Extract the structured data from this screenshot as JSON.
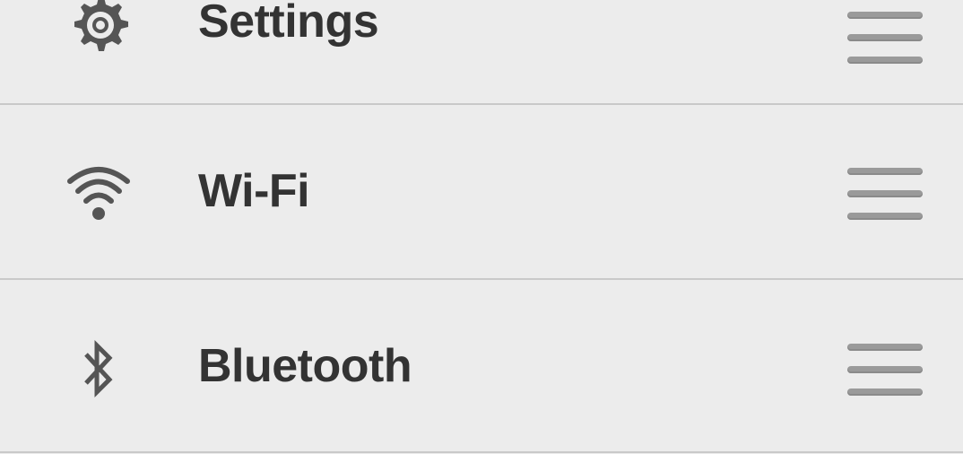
{
  "items": [
    {
      "label": "Settings",
      "icon": "gear-icon"
    },
    {
      "label": "Wi-Fi",
      "icon": "wifi-icon"
    },
    {
      "label": "Bluetooth",
      "icon": "bluetooth-icon"
    }
  ],
  "drag_handle_icon": "drag-handle-icon",
  "colors": {
    "background": "#ececec",
    "divider": "#c9c9c9",
    "text": "#333333",
    "icon": "#555555",
    "handle": "#9a9a9a"
  }
}
